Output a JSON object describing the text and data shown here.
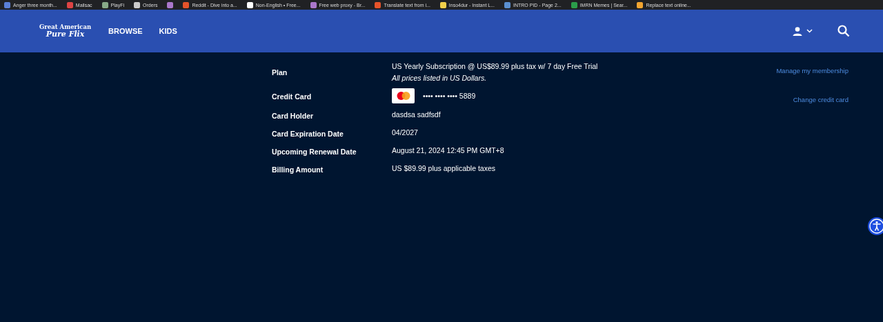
{
  "bookmarks": [
    {
      "label": "Anger three month...",
      "color": "#5a7fd6"
    },
    {
      "label": "Mailsac",
      "color": "#dd4444"
    },
    {
      "label": "PlayFi",
      "color": "#88aa88"
    },
    {
      "label": "Orders",
      "color": "#cccccc"
    },
    {
      "color": "#aa77cc"
    },
    {
      "label": "Reddit - Dive into a...",
      "color": "#e5532a"
    },
    {
      "label": "Non-English • Free...",
      "color": "#ffffff"
    },
    {
      "label": "Free web proxy - Br...",
      "color": "#aa77cc"
    },
    {
      "label": "Translate text from i...",
      "color": "#e5532a"
    },
    {
      "label": "Insо4dur - Instant L...",
      "color": "#f2d04a"
    },
    {
      "label": "INTRO PID - Page 2...",
      "color": "#5a8fd0"
    },
    {
      "label": "IMRN Memes | Sear...",
      "color": "#2b9d4a"
    },
    {
      "label": "Replace text online...",
      "color": "#f2a530"
    }
  ],
  "header": {
    "logo": [
      "Great American",
      "Pure Flix"
    ],
    "nav": [
      {
        "label": "BROWSE"
      },
      {
        "label": "KIDS"
      }
    ]
  },
  "details": [
    {
      "kind": "text",
      "label": "Plan",
      "value": "US Yearly Subscription @ US$89.99 plus tax w/ 7 day Free Trial",
      "note": "All prices listed in US Dollars.",
      "action": "Manage my membership"
    },
    {
      "kind": "card",
      "label": "Credit Card",
      "value": "•••• •••• •••• 5889",
      "action": "Change credit card"
    },
    {
      "kind": "text",
      "label": "Card Holder",
      "value": "dasdsa sadfsdf"
    },
    {
      "kind": "text",
      "label": "Card Expiration Date",
      "value": "04/2027"
    },
    {
      "kind": "text",
      "label": "Upcoming Renewal Date",
      "value": "August 21, 2024 12:45 PM GMT+8"
    },
    {
      "kind": "text",
      "label": "Billing Amount",
      "value": "US $89.99 plus applicable taxes"
    }
  ]
}
